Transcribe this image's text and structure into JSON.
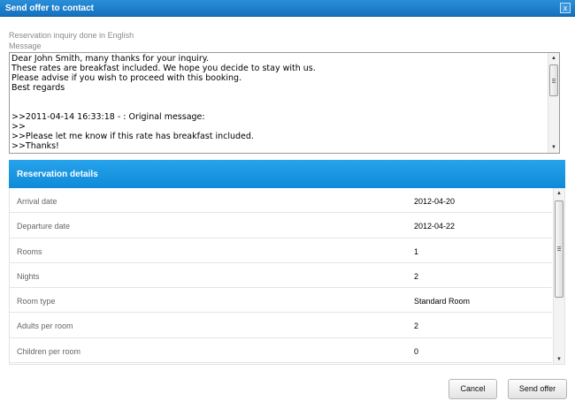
{
  "window": {
    "title": "Send offer to contact",
    "close_glyph": "x",
    "close_icon": "close-icon"
  },
  "inquiry_note": "Reservation inquiry done in English",
  "message": {
    "label": "Message",
    "text": "Dear John Smith, many thanks for your inquiry.\nThese rates are breakfast included. We hope you decide to stay with us.\nPlease advise if you wish to proceed with this booking.\nBest regards\n\n\n>>2011-04-14 16:33:18 - : Original message:\n>>\n>>Please let me know if this rate has breakfast included.\n>>Thanks!"
  },
  "details": {
    "title": "Reservation details",
    "rows": [
      {
        "label": "Arrival date",
        "value": "2012-04-20"
      },
      {
        "label": "Departure date",
        "value": "2012-04-22"
      },
      {
        "label": "Rooms",
        "value": "1"
      },
      {
        "label": "Nights",
        "value": "2"
      },
      {
        "label": "Room type",
        "value": "Standard Room"
      },
      {
        "label": "Adults per room",
        "value": "2"
      },
      {
        "label": "Children per room",
        "value": "0"
      }
    ]
  },
  "buttons": {
    "cancel": "Cancel",
    "send": "Send offer"
  },
  "colors": {
    "titlebar": "#1470bf",
    "header": "#1a97e3"
  }
}
